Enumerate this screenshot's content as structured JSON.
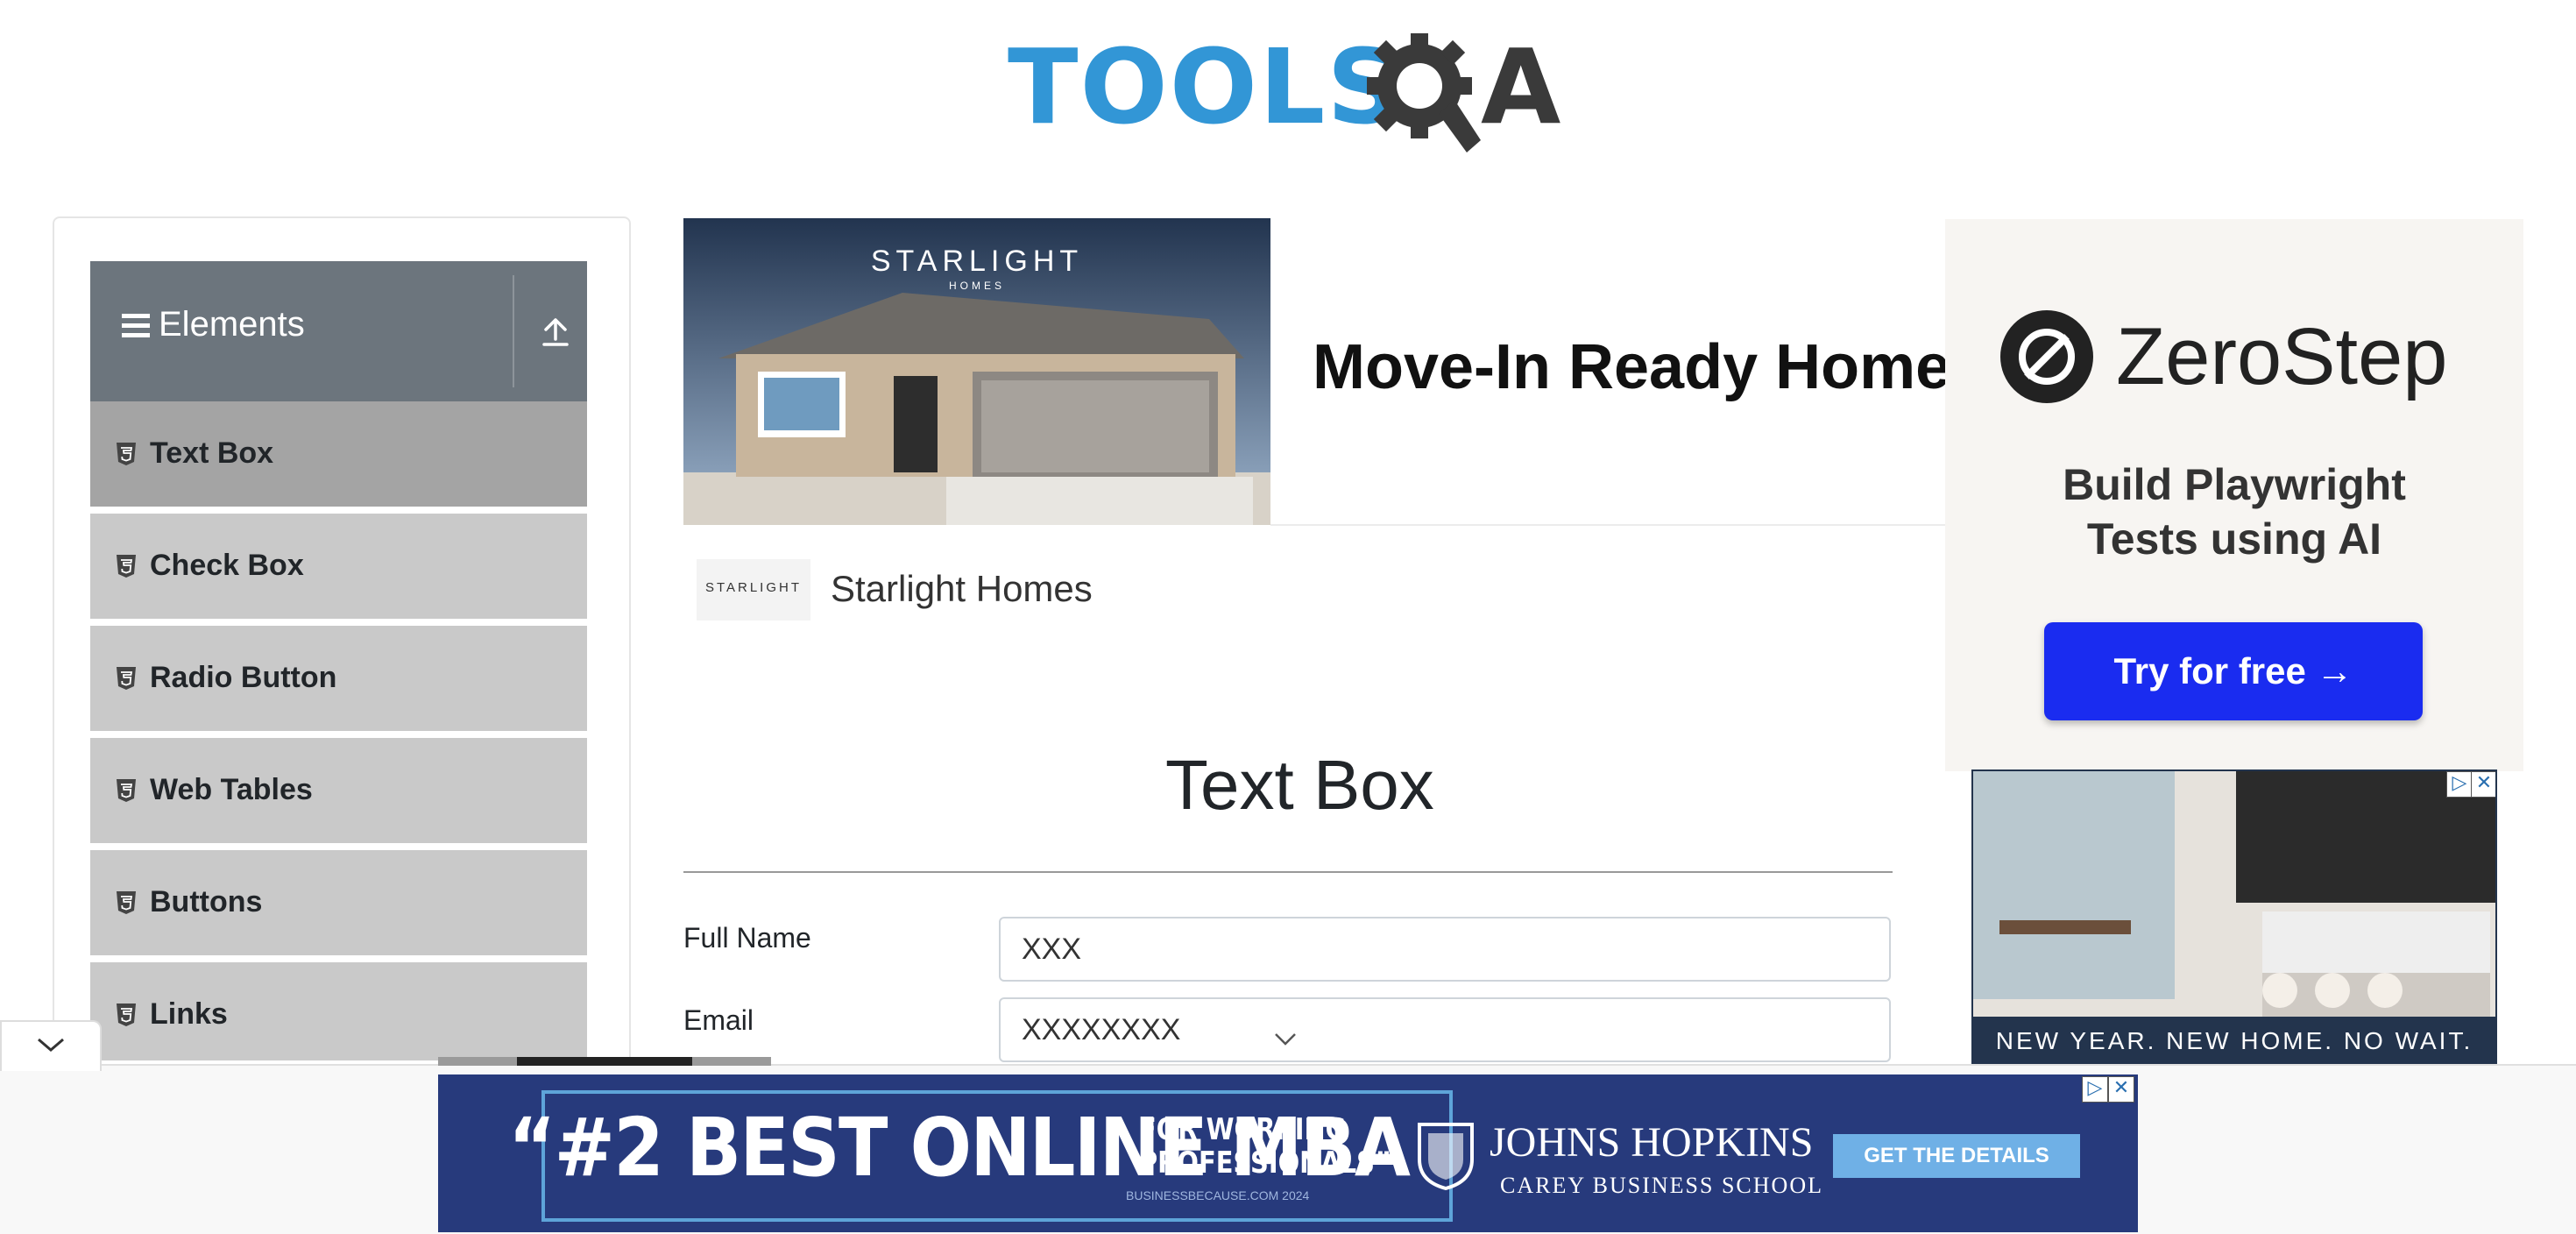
{
  "header": {
    "logo_text": "TOOLS",
    "logo_tail": "A"
  },
  "sidebar": {
    "group_title": "Elements",
    "items": [
      {
        "label": "Text Box",
        "active": true
      },
      {
        "label": "Check Box"
      },
      {
        "label": "Radio Button"
      },
      {
        "label": "Web Tables"
      },
      {
        "label": "Buttons"
      },
      {
        "label": "Links"
      }
    ]
  },
  "top_ad": {
    "image_brand": "STARLIGHT",
    "image_brand_sub": "HOMES",
    "heading": "Move-In Ready Homes",
    "advertiser_logo_text": "STARLIGHT",
    "advertiser_name": "Starlight Homes"
  },
  "form": {
    "title": "Text Box",
    "full_name_label": "Full Name",
    "full_name_value": "XXX",
    "email_label": "Email",
    "email_value": "XXXXXXXX"
  },
  "side_ad": {
    "brand": "ZeroStep",
    "tagline_1": "Build Playwright",
    "tagline_2": "Tests using AI",
    "cta": "Try for free →",
    "second_caption": "NEW YEAR. NEW HOME. NO WAIT."
  },
  "bottom_ad": {
    "headline": "“#2 BEST ONLINE MBA",
    "sub_1": "FOR WORKING",
    "sub_2": "PROFESSIONALS”",
    "fine_print": "BUSINESSBECAUSE.COM 2024",
    "school": "JOHNS HOPKINS",
    "school_sub": "CAREY BUSINESS SCHOOL",
    "cta": "GET THE DETAILS"
  },
  "colors": {
    "logo_blue": "#3296d6",
    "sidebar_header": "#6c757d",
    "sidebar_item": "#c9c9c9",
    "sidebar_item_active": "#a4a4a4",
    "zerostep_cta": "#1a2cf0",
    "banner_navy": "#273a7c"
  }
}
